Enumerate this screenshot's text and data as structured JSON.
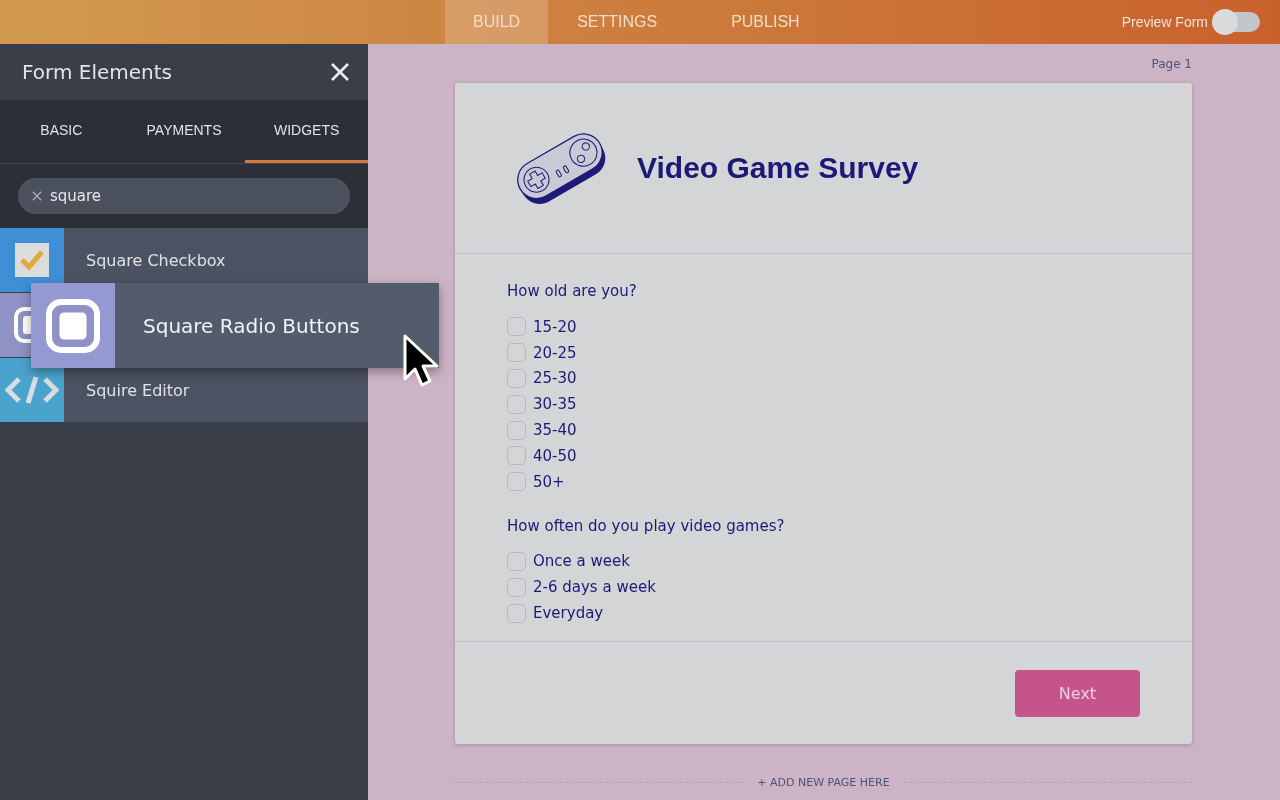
{
  "top_bar": {
    "tabs": [
      {
        "label": "BUILD",
        "selected": true
      },
      {
        "label": "SETTINGS",
        "selected": false
      },
      {
        "label": "PUBLISH",
        "selected": false
      }
    ],
    "preview": {
      "label": "Preview Form",
      "on": false
    }
  },
  "sidebar": {
    "title": "Form Elements",
    "tabs": [
      {
        "label": "BASIC",
        "selected": false
      },
      {
        "label": "PAYMENTS",
        "selected": false
      },
      {
        "label": "WIDGETS",
        "selected": true
      }
    ],
    "search": {
      "value": "square"
    },
    "items": [
      {
        "kind": "checkbox",
        "label": "Square Checkbox",
        "color": "#3f8fd6"
      },
      {
        "kind": "radio",
        "color": "#8f92c4"
      },
      {
        "kind": "code",
        "label": "Squire Editor",
        "color": "#4aa3cc"
      }
    ],
    "dragged_item": {
      "kind": "radio",
      "label": "Square Radio Buttons"
    }
  },
  "form": {
    "page_label": "Page 1",
    "title": "Video Game Survey",
    "questions": [
      {
        "label": "How old are you?",
        "options": [
          {
            "label": "15-20",
            "checked": false
          },
          {
            "label": "20-25",
            "checked": false
          },
          {
            "label": "25-30",
            "checked": false
          },
          {
            "label": "30-35",
            "checked": false
          },
          {
            "label": "35-40",
            "checked": false
          },
          {
            "label": "40-50",
            "checked": false
          },
          {
            "label": "50+",
            "checked": false
          }
        ]
      },
      {
        "label": "How often do you play video games?",
        "options": [
          {
            "label": "Once a week",
            "checked": false
          },
          {
            "label": "2-6 days a week",
            "checked": false
          },
          {
            "label": "Everyday",
            "checked": false
          }
        ]
      }
    ],
    "next_button": "Next",
    "add_page": "+ ADD NEW PAGE HERE"
  }
}
